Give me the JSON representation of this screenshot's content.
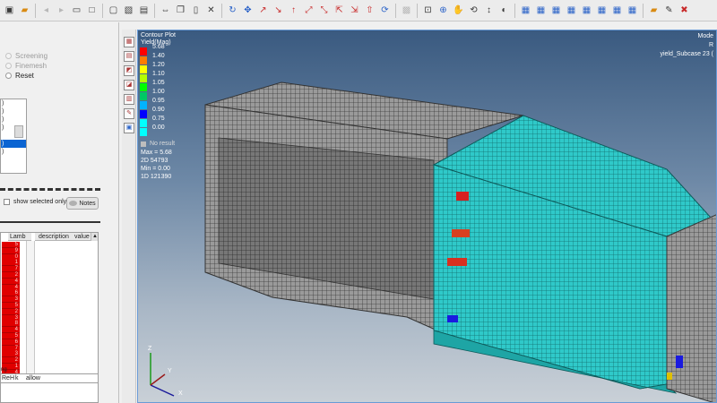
{
  "toolbar": {
    "icons": [
      "new-icon",
      "open-folder-icon",
      "undo-icon",
      "redo-icon",
      "save-icon",
      "box-icon",
      "rect-select-icon",
      "select-icon",
      "print-icon",
      "move-icon",
      "copy-icon",
      "paste-icon",
      "delete-icon",
      "rotate-icon",
      "translate-icon",
      "axis-x-icon",
      "axis-y-icon",
      "axis-z-icon",
      "axis-xy-icon",
      "axis-yz-icon",
      "axis-xz-icon",
      "axis-iso-icon",
      "axis-neg-icon",
      "refresh-icon",
      "disabled-icon",
      "zoom-fit-icon",
      "zoom-in-icon",
      "pan-icon",
      "rotate-view-icon",
      "spin-icon",
      "view-toggle-icon",
      "display-a-icon",
      "display-b-icon",
      "display-c-icon",
      "display-d-icon",
      "display-e-icon",
      "display-f-icon",
      "display-g-icon",
      "display-h-icon",
      "folder-icon",
      "edit-icon",
      "close-icon"
    ]
  },
  "left_panel": {
    "radios": [
      {
        "label": "Screening",
        "enabled": false
      },
      {
        "label": "Finemesh",
        "enabled": false
      },
      {
        "label": "Reset",
        "enabled": true
      }
    ],
    "list_items": [
      ")",
      ")",
      ")",
      ")",
      "",
      ")",
      ")",
      "",
      "",
      "",
      "",
      "",
      ""
    ],
    "list_selected_index": 5,
    "show_selected_label": "show selected only",
    "notes_label": "Notes",
    "grid": {
      "lamb_header": "Lamb",
      "description_header": "description",
      "value_header": "value",
      "lamb_values": [
        "5",
        "9",
        "0",
        "1",
        "7",
        "2",
        "4",
        "4",
        "6",
        "3",
        "5",
        "2",
        "3",
        "8",
        "4",
        "5",
        "6",
        "7",
        "3",
        "2",
        "1",
        "4",
        "9"
      ],
      "side_labels": [
        "ng",
        "ng"
      ]
    },
    "bottom_headers": [
      "ReH",
      "k",
      "allow"
    ]
  },
  "viewport": {
    "contour_title": "Contour Plot",
    "result_type": "Yield(Mag)",
    "legend": [
      {
        "value": "5.68",
        "color": "#ff0000"
      },
      {
        "value": "1.40",
        "color": "#ff7d00"
      },
      {
        "value": "1.20",
        "color": "#ffff00"
      },
      {
        "value": "1.10",
        "color": "#b4ff00"
      },
      {
        "value": "1.05",
        "color": "#00ff00"
      },
      {
        "value": "1.00",
        "color": "#00c864"
      },
      {
        "value": "0.95",
        "color": "#00b4ff"
      },
      {
        "value": "0.90",
        "color": "#0000ff"
      },
      {
        "value": "0.75",
        "color": "#00ffff"
      },
      {
        "value": "0.00",
        "color": "#00ffff"
      }
    ],
    "no_result": "No result",
    "max_line": "Max = 5.68",
    "line_2d": "2D 54793",
    "min_line": "Min = 0.00",
    "line_1d": "1D 121390",
    "corner_model": "Mode",
    "corner_r": "R",
    "corner_subcase": "yield_Subcase 23 (",
    "triad": {
      "z": "Z",
      "y": "Y",
      "x": "X"
    }
  }
}
